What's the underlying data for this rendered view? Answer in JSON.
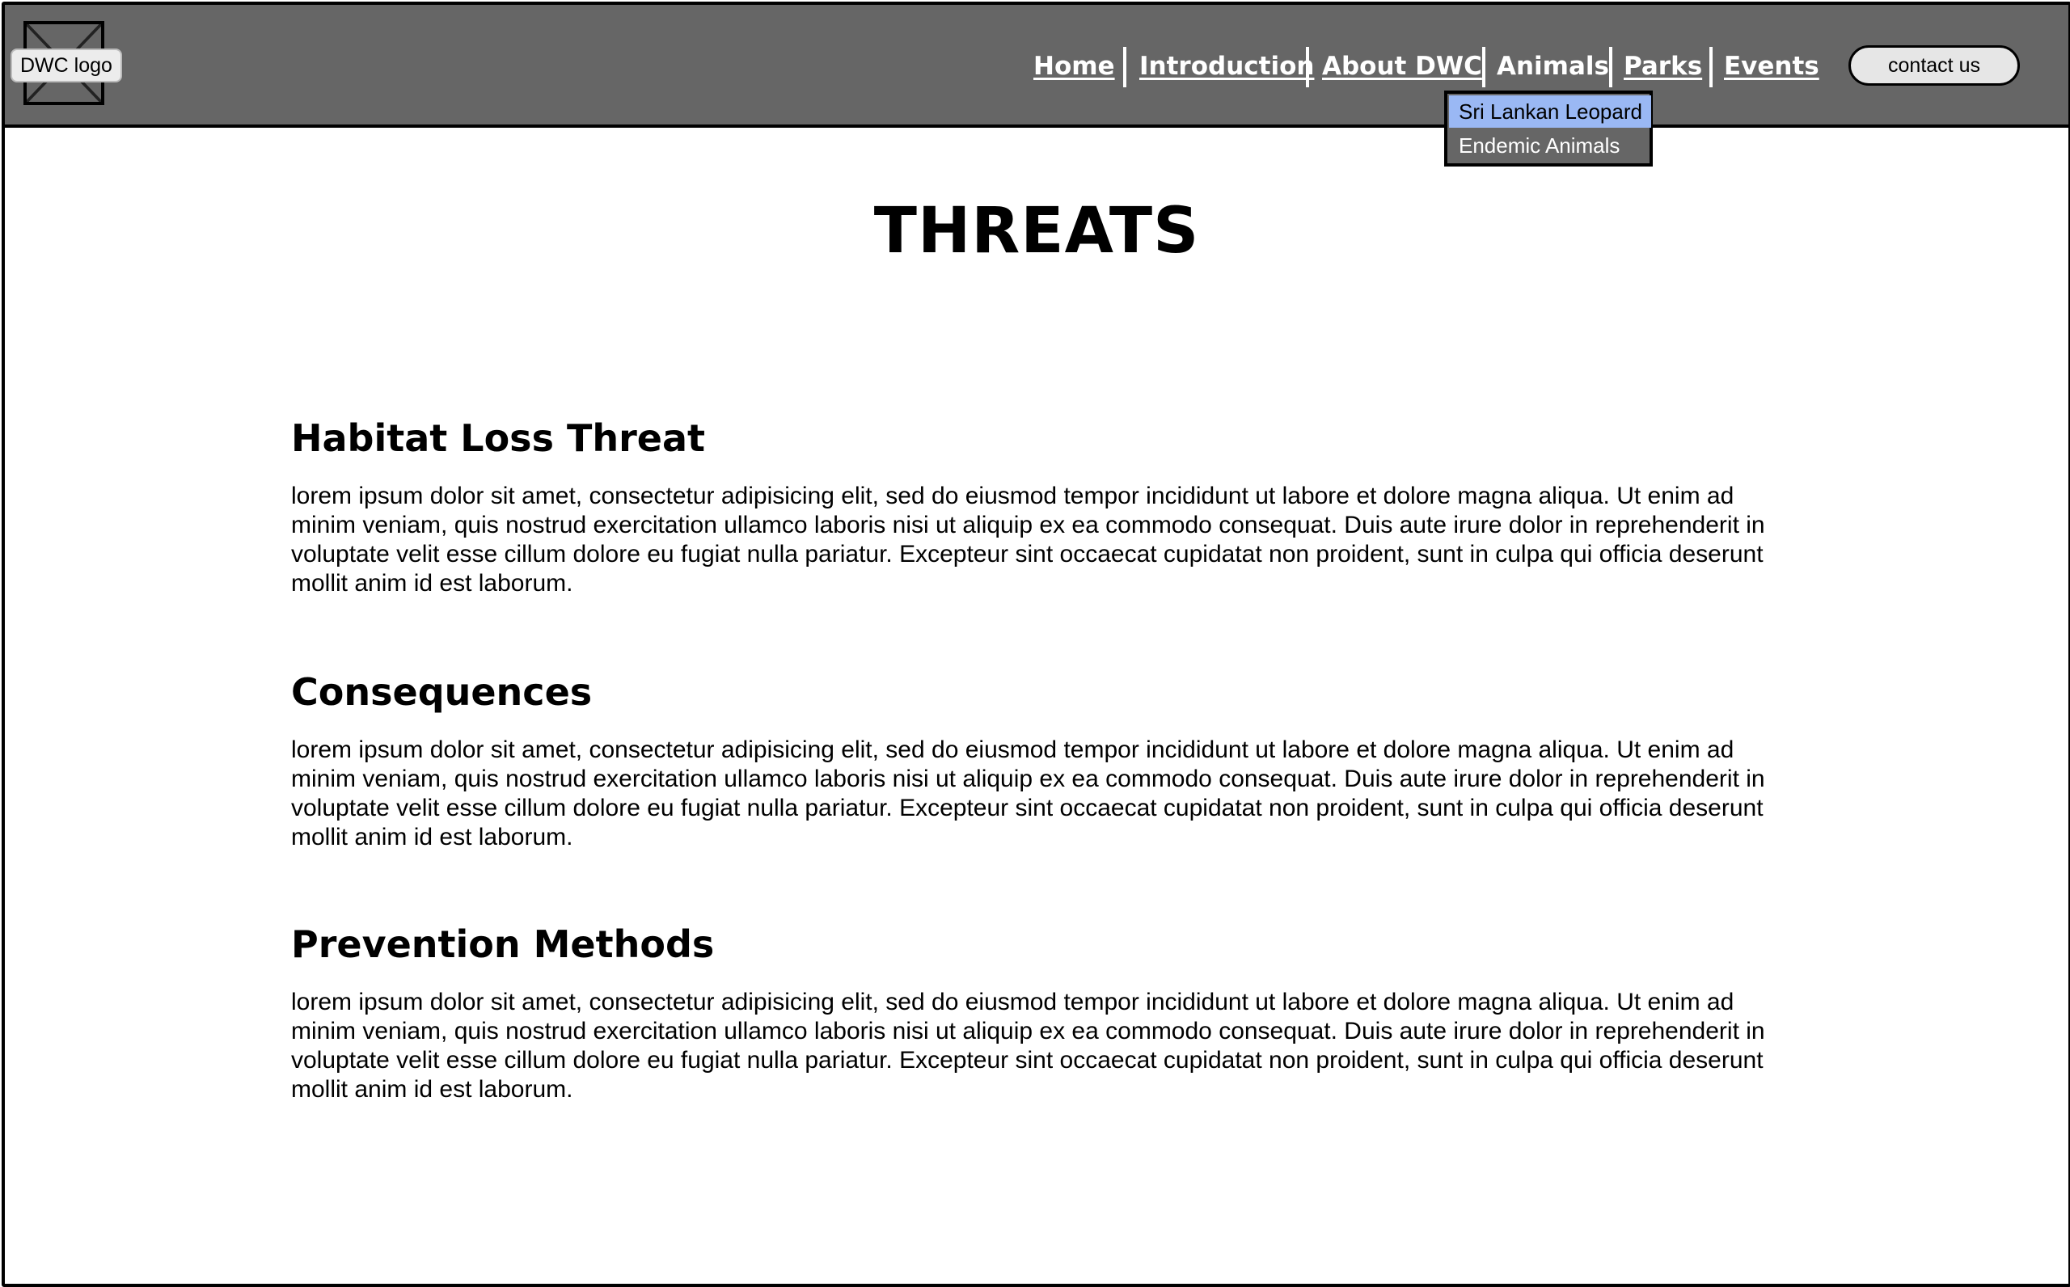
{
  "header": {
    "logo_label": "DWC logo",
    "nav": {
      "home": "Home",
      "introduction": "Introduction",
      "about": "About DWC",
      "animals": "Animals",
      "parks": "Parks",
      "events": "Events"
    },
    "contact_label": "contact us"
  },
  "dropdown": {
    "items": [
      "Sri Lankan Leopard",
      "Endemic Animals"
    ],
    "selected": "Sri Lankan Leopard"
  },
  "page": {
    "title": "THREATS",
    "sections": [
      {
        "heading": "Habitat Loss Threat",
        "body": "lorem ipsum dolor sit amet, consectetur adipisicing elit, sed do eiusmod tempor incididunt ut labore et dolore magna aliqua. Ut enim ad minim veniam, quis nostrud exercitation ullamco laboris nisi ut aliquip ex ea commodo consequat. Duis aute irure dolor in reprehenderit in voluptate velit esse cillum dolore eu fugiat nulla pariatur. Excepteur sint occaecat cupidatat non proident, sunt in culpa qui officia deserunt mollit anim id est laborum."
      },
      {
        "heading": "Consequences",
        "body": "lorem ipsum dolor sit amet, consectetur adipisicing elit, sed do eiusmod tempor incididunt ut labore et dolore magna aliqua. Ut enim ad minim veniam, quis nostrud exercitation ullamco laboris nisi ut aliquip ex ea commodo consequat. Duis aute irure dolor in reprehenderit in voluptate velit esse cillum dolore eu fugiat nulla pariatur. Excepteur sint occaecat cupidatat non proident, sunt in culpa qui officia deserunt mollit anim id est laborum."
      },
      {
        "heading": "Prevention Methods",
        "body": "lorem ipsum dolor sit amet, consectetur adipisicing elit, sed do eiusmod tempor incididunt ut labore et dolore magna aliqua. Ut enim ad minim veniam, quis nostrud exercitation ullamco laboris nisi ut aliquip ex ea commodo consequat. Duis aute irure dolor in reprehenderit in voluptate velit esse cillum dolore eu fugiat nulla pariatur. Excepteur sint occaecat cupidatat non proident, sunt in culpa qui officia deserunt mollit anim id est laborum."
      }
    ]
  },
  "colors": {
    "header_bg": "#666666",
    "dropdown_highlight": "#9ab8f4",
    "nav_text": "#ffffff"
  },
  "icons": [
    "image-placeholder-icon"
  ]
}
